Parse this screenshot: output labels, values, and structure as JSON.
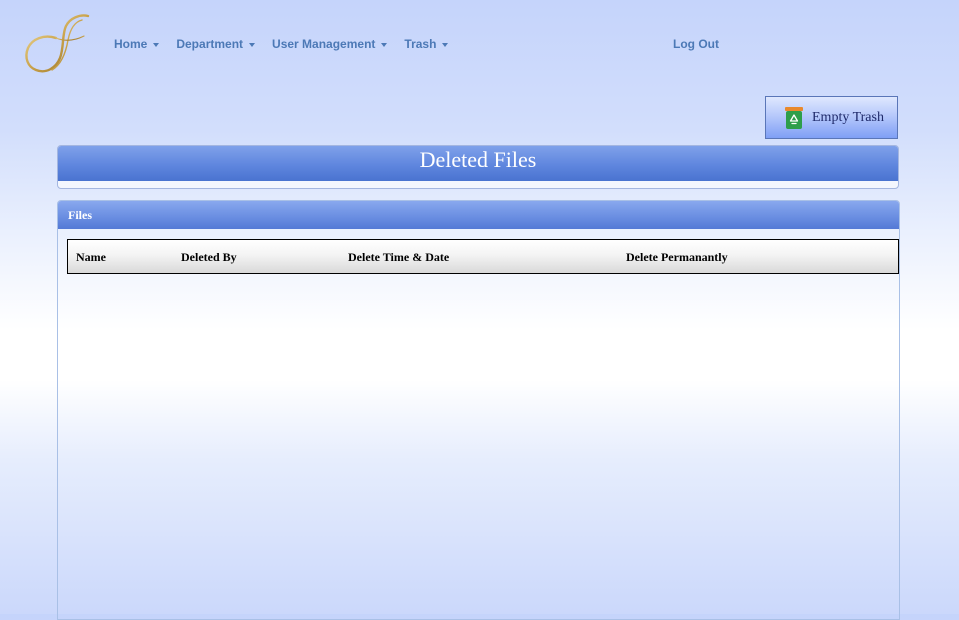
{
  "logo": {
    "letter": "J",
    "icon": "script-j-logo"
  },
  "nav": {
    "items": [
      {
        "label": "Home",
        "icon": "caret-down-icon"
      },
      {
        "label": "Department",
        "icon": "caret-down-icon"
      },
      {
        "label": "User Management",
        "icon": "caret-down-icon"
      },
      {
        "label": "Trash",
        "icon": "caret-down-icon"
      }
    ],
    "logout_label": "Log Out"
  },
  "toolbar": {
    "empty_trash_label": "Empty Trash",
    "empty_trash_icon": "recycle-bin-icon"
  },
  "page": {
    "title": "Deleted Files"
  },
  "files_panel": {
    "heading": "Files",
    "columns": [
      "Name",
      "Deleted By",
      "Delete Time & Date",
      "Delete Permanantly"
    ],
    "rows": []
  },
  "colors": {
    "nav_link": "#4c79b6",
    "panel_header": "#5f86de",
    "logo_gold": "#c9a24a",
    "bin_green": "#2e9e4a",
    "bin_orange": "#e8892c"
  }
}
